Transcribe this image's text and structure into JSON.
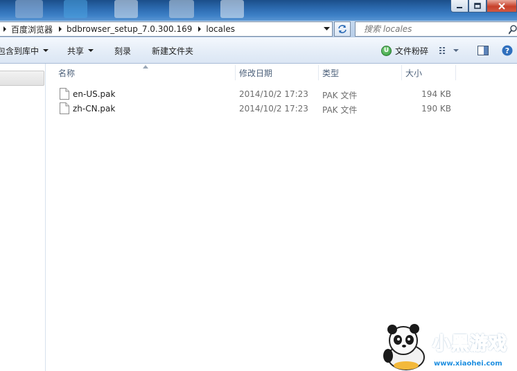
{
  "titlebar": {
    "buttons": [
      {
        "name": "minimize-button"
      },
      {
        "name": "maximize-button"
      },
      {
        "name": "close-button"
      }
    ]
  },
  "address": {
    "crumbs": [
      "百度浏览器",
      "bdbrowser_setup_7.0.300.169",
      "locales"
    ]
  },
  "search": {
    "placeholder": "搜索 locales"
  },
  "toolbar": {
    "include_library": "包含到库中",
    "share": "共享",
    "burn": "刻录",
    "new_folder": "新建文件夹",
    "shredder": "文件粉碎",
    "shredder_badge": "U"
  },
  "columns": {
    "name": "名称",
    "modified": "修改日期",
    "type": "类型",
    "size": "大小"
  },
  "files": [
    {
      "name": "en-US.pak",
      "modified": "2014/10/2 17:23",
      "type": "PAK 文件",
      "size": "194 KB"
    },
    {
      "name": "zh-CN.pak",
      "modified": "2014/10/2 17:23",
      "type": "PAK 文件",
      "size": "190 KB"
    }
  ],
  "watermark": {
    "brand": "小黑游戏",
    "url": "www.xiaohei.com"
  },
  "colors": {
    "title_glass": "#2e6db3",
    "address_bar": "#c5d9ef",
    "command_bar": "#e6eef8",
    "column_header_text": "#4c607a",
    "detail_text": "#6d6d6d",
    "watermark_blue": "#1f8fe0"
  }
}
